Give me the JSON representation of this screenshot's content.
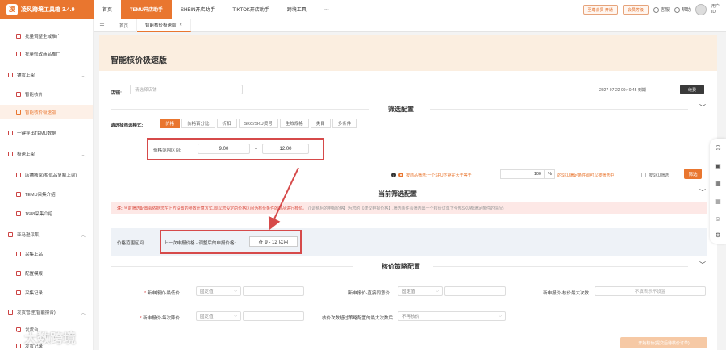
{
  "app": {
    "brand": "凌风跨境工具箱 3.4.9",
    "logo_glyph": "凌",
    "accent": "#e9762f",
    "highlight": "#d64a4a"
  },
  "topnav": {
    "items": [
      "首页",
      "TEMU开店助手",
      "SHEIN开店助手",
      "TIKTOK开店助手",
      "跨境工具",
      "···"
    ],
    "active_index": 1,
    "upgrade": "至尊会员 开通",
    "vip": "会员等级",
    "service": "客服",
    "help": "帮助",
    "user_line1": "用户",
    "user_line2": "ID"
  },
  "sidebar": {
    "items": [
      {
        "label": "批量调整全域推广",
        "kind": "sub"
      },
      {
        "label": "批量修改商品推广",
        "kind": "sub"
      },
      {
        "label": "铺货上架",
        "kind": "group"
      },
      {
        "label": "智能核价",
        "kind": "sub"
      },
      {
        "label": "智能核价极速版",
        "kind": "sub",
        "active": true
      },
      {
        "label": "一键导出TEMU数据",
        "kind": "group"
      },
      {
        "label": "极速上架",
        "kind": "group"
      },
      {
        "label": "店铺搬家(相似品复制上架)",
        "kind": "sub"
      },
      {
        "label": "TEMU采集介绍",
        "kind": "sub"
      },
      {
        "label": "1688采集介绍",
        "kind": "sub"
      },
      {
        "label": "亚马逊采集",
        "kind": "group"
      },
      {
        "label": "采集上品",
        "kind": "sub"
      },
      {
        "label": "配置模版",
        "kind": "sub"
      },
      {
        "label": "采集记录",
        "kind": "sub"
      },
      {
        "label": "发货管理(智能拼合)",
        "kind": "group"
      },
      {
        "label": "发货台",
        "kind": "sub"
      },
      {
        "label": "发货记录",
        "kind": "sub"
      }
    ]
  },
  "tabs": {
    "home": "首页",
    "active": "智能核价极速版",
    "close": "×"
  },
  "page": {
    "title": "智能核价极速版",
    "shop_label": "店铺:",
    "shop_placeholder": "请选择店铺",
    "datetime": "2027-07-22 09:40:45 到期",
    "refresh": "续费"
  },
  "filter": {
    "section_title": "筛选配置",
    "mode_label": "请选择筛选模式:",
    "modes": [
      "价格",
      "价格百分比",
      "折扣",
      "SKC/SKU货号",
      "生效规格",
      "类目",
      "多条件"
    ],
    "active_mode": 0,
    "range_label": "价格范围区间:",
    "range_min": "9.00",
    "range_max": "12.00",
    "range_dash": "-",
    "info": "i",
    "cond_text": "按商品筛选:一个SPU下存在大于等于",
    "pct_value": "100",
    "pct_unit": "%",
    "cond_text2": "的SKU满足条件即可以被筛选中",
    "sku_check": "按SKU筛选",
    "button": "筛选"
  },
  "current": {
    "section_title": "当前筛选配置",
    "notice_mark": "注:",
    "notice": "当前筛选配置会依据您在上方设置的参数计算方式,即以您设定的价格区间为核价条件的商品进行核价。",
    "notice_tail": "(【调整后的申报价格】为您的【建议申报价格】,筛选条件会筛选出一个核价订单下全部SKU都满足条件的情况)",
    "label": "价格范围区间:",
    "text": "上一次申报价格 - 调整后的申报价格:",
    "value": "在 9 - 12 以内"
  },
  "strategy": {
    "section_title": "核价策略配置",
    "fields": [
      {
        "label": "新申报价-最低价",
        "required": true,
        "select": "固定值"
      },
      {
        "label": "新申报价-直接同意价",
        "required": false,
        "select": "固定值"
      },
      {
        "label": "新申报价-核价最大次数",
        "required": false,
        "input": "不填表示不设置"
      },
      {
        "label": "新申报价-每次降价",
        "required": true,
        "select": "固定值"
      },
      {
        "label": "核价次数超过策略配置的最大次数后",
        "required": false,
        "select": "不再核价"
      }
    ],
    "dropdown": "⌵"
  },
  "bottom_button": "开始核价(提交后待核价订单)",
  "watermark": "大数跨境"
}
